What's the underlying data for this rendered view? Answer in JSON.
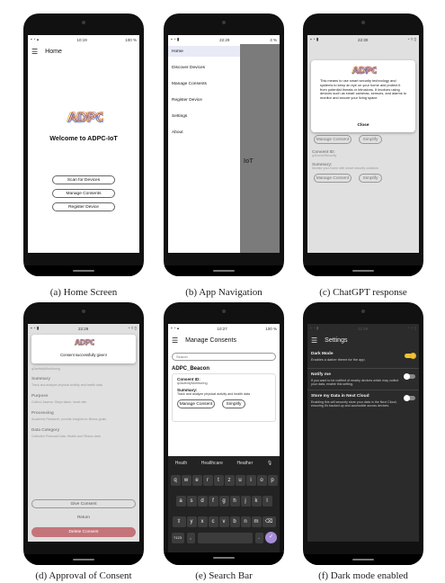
{
  "logo_text": "ADPC",
  "status": {
    "a_time": "10:19",
    "a_batt": "100 %",
    "b_time": "22:29",
    "b_batt": "3 %",
    "c_time": "22:30",
    "d_time": "22:29",
    "e_time": "10:27",
    "e_batt": "100 %",
    "f_time": "22:29"
  },
  "home": {
    "title": "Home",
    "welcome": "Welcome to ADPC-IoT",
    "scan_label": "Scan for Devices",
    "manage_label": "Manage Consents",
    "register_label": "Register Device"
  },
  "nav": {
    "items": [
      "Home",
      "Discover Devices",
      "Manage Consents",
      "Register Device",
      "Settings",
      "About"
    ],
    "behind_text": "IoT"
  },
  "chatgpt": {
    "message": "This means to use smart security technology and systems to keep an eye on your home and protect it from potential threats or intrusions. It involves using devices such as smart cameras, sensors, and alarms to monitor and secure your living space.",
    "close_label": "Close",
    "manage_label": "Manage Consent",
    "simplify_label": "Simplify",
    "consent_id_label": "Consent ID:",
    "consent_id_value": "q2homeSecurity",
    "summary_label": "Summary:",
    "summary_value": "Monitor your home with smart security solutions"
  },
  "approval": {
    "toast": "Consent successfully given!",
    "id_value": "q2activityMonitoring",
    "summary_label": "Summary",
    "summary_value": "Track and analyze physical activity and health data",
    "purpose_label": "Purpose",
    "purpose_value": "Collect, Assess: Steps taken, heart rate",
    "processing_label": "Processing",
    "processing_value": "Academic Research: provide insights for fitness goals",
    "category_label": "Data Category",
    "category_value": "Collected Personal Data: Health and Fitness data",
    "give_label": "Give Consent",
    "return_label": "Return",
    "delete_label": "Delete Consent"
  },
  "search": {
    "title": "Manage Consents",
    "placeholder": "Search",
    "device": "ADPC_Beacon",
    "consent_id_label": "Consent ID:",
    "consent_id_value": "q2activityMonitoring",
    "summary_label": "Summary:",
    "summary_value": "Track and analyze physical activity and health data",
    "manage_label": "Manage Consent",
    "simplify_label": "Simplify",
    "suggestions": [
      "Heath",
      "Healthcare",
      "Heather"
    ],
    "row1": [
      "q",
      "w",
      "e",
      "r",
      "t",
      "z",
      "u",
      "i",
      "o",
      "p"
    ],
    "row2": [
      "a",
      "s",
      "d",
      "f",
      "g",
      "h",
      "j",
      "k",
      "l"
    ],
    "row3": [
      "y",
      "x",
      "c",
      "v",
      "b",
      "n",
      "m"
    ],
    "numkey": "?123"
  },
  "settings": {
    "title": "Settings",
    "dark_title": "Dark Mode",
    "dark_desc": "Enables a darker theme for the app.",
    "notify_title": "Notify me",
    "notify_desc": "If you want to be notified of nearby devices which may collect your data, enable this setting.",
    "cloud_title": "Store my Data in Next Cloud",
    "cloud_desc": "Enabling this will securely store your data in the Next Cloud, ensuring it's backed up and accessible across devices."
  },
  "captions": [
    "(a) Home Screen",
    "(b) App Navigation",
    "(c) ChatGPT response",
    "(d) Approval of Consent",
    "(e) Search Bar",
    "(f) Dark mode enabled"
  ],
  "colors": {
    "accent_yellow": "#f2c233",
    "delete_red": "#c4757a",
    "dark_bg": "#2b2b2b"
  }
}
